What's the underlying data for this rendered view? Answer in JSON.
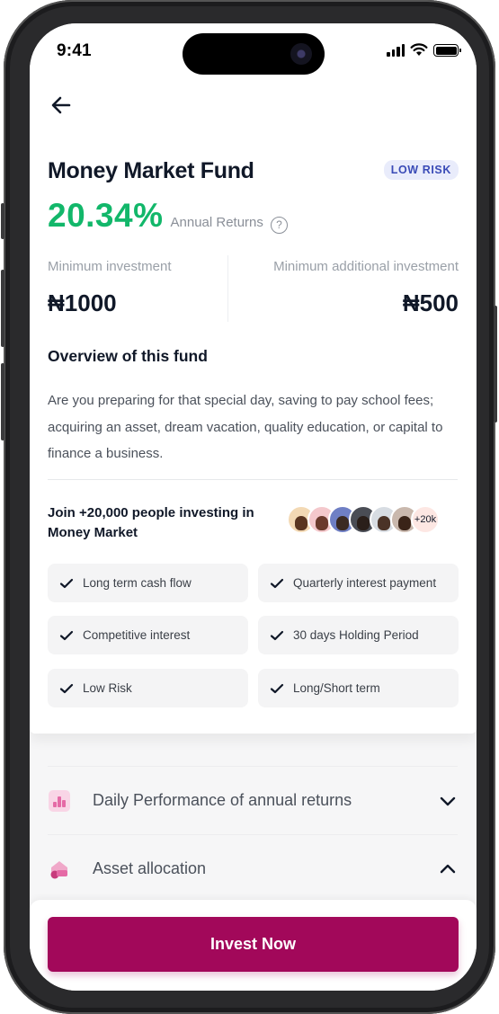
{
  "status_bar": {
    "time": "9:41"
  },
  "fund": {
    "title": "Money Market Fund",
    "risk_badge": "LOW RISK",
    "returns_value": "20.34%",
    "returns_label": "Annual Returns"
  },
  "investment": {
    "min_label": "Minimum investment",
    "min_value": "₦1000",
    "additional_label": "Minimum additional investment",
    "additional_value": "₦500"
  },
  "overview": {
    "title": "Overview of this fund",
    "text": "Are you preparing for that special day, saving to pay school fees; acquiring an asset, dream vacation, quality education, or capital to finance a business."
  },
  "community": {
    "join_text": "Join +20,000 people investing in Money Market",
    "avatar_count": "+20k"
  },
  "features": [
    "Long term cash flow",
    "Quarterly interest payment",
    "Competitive interest",
    "30 days Holding Period",
    "Low Risk",
    "Long/Short term"
  ],
  "accordions": [
    {
      "label": "Daily Performance of annual returns",
      "icon": "chart-icon",
      "state": "collapsed"
    },
    {
      "label": "Asset allocation",
      "icon": "pie-chart-icon",
      "state": "expanded"
    }
  ],
  "cta": {
    "label": "Invest Now"
  },
  "colors": {
    "accent": "#a2085a",
    "returns_green": "#12b76a",
    "badge_bg": "#e9ecfb",
    "badge_text": "#3a4bb7"
  }
}
